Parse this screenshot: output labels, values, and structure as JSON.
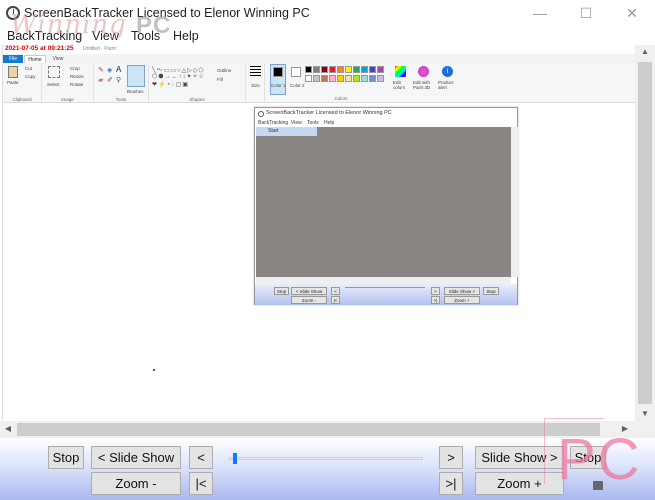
{
  "window": {
    "title": "ScreenBackTracker Licensed to Elenor Winning PC",
    "watermark_script": "Winning",
    "watermark_block": "PC",
    "minimize_glyph": "—",
    "maximize_glyph": "☐",
    "close_glyph": "✕"
  },
  "menu": {
    "items": [
      "BackTracking",
      "View",
      "Tools",
      "Help"
    ]
  },
  "capture": {
    "timestamp": "2021-07-05 at 09:21:25",
    "paint_title": "Untitled - Paint",
    "tabs": {
      "file": "File",
      "home": "Home",
      "view": "View"
    },
    "groups": {
      "clipboard": "Clipboard",
      "image": "Image",
      "tools": "Tools",
      "shapes": "Shapes",
      "colors": "Colors"
    },
    "labels": {
      "paste": "Paste",
      "cut": "Cut",
      "copy": "Copy",
      "select": "Select",
      "crop": "Crop",
      "resize": "Resize",
      "rotate": "Rotate",
      "brushes": "Brushes",
      "outline": "Outline",
      "fill": "Fill",
      "size": "Size",
      "color1": "Color 1",
      "color2": "Color 2",
      "edit_colors": "Edit colors",
      "edit_paint3d": "Edit with Paint 3D",
      "product_alert": "Product alert"
    },
    "palette_row1": [
      "#000000",
      "#7f7f7f",
      "#880015",
      "#ed1c24",
      "#ff7f27",
      "#fff200",
      "#22b14c",
      "#00a2e8",
      "#3f48cc",
      "#a349a4"
    ],
    "palette_row2": [
      "#ffffff",
      "#c3c3c3",
      "#b97a57",
      "#ffaec9",
      "#ffc90e",
      "#efe4b0",
      "#b5e61d",
      "#99d9ea",
      "#7092be",
      "#c8bfe7"
    ]
  },
  "embedded": {
    "title": "ScreenBackTracker Licensed to Elenor Winning PC",
    "menu": [
      "BackTracking",
      "View",
      "Tools",
      "Help"
    ],
    "start": "Start",
    "stop": "Stop",
    "slide_show_back": "< Slide Show",
    "back": "<",
    "forward": ">",
    "slide_show_fwd": "Slide Show >",
    "stop2": "Stop",
    "zoom_out": "Zoom -",
    "first": "|<",
    "last": ">|",
    "zoom_in": "Zoom +"
  },
  "controls": {
    "stop_left": "Stop",
    "slide_show_back": "< Slide Show",
    "prev": "<",
    "next": ">",
    "slide_show_fwd": "Slide Show >",
    "stop_right": "Stop",
    "zoom_out": "Zoom -",
    "first": "|<",
    "last": ">|",
    "zoom_in": "Zoom +",
    "slider_position": 0.02
  },
  "overlay_logo": "PC",
  "colors": {
    "panel_gradient_bottom": "#aab7ef",
    "slider_accent": "#1677ff",
    "timestamp_red": "#dd0000",
    "logo_pink": "#ec78a0"
  }
}
